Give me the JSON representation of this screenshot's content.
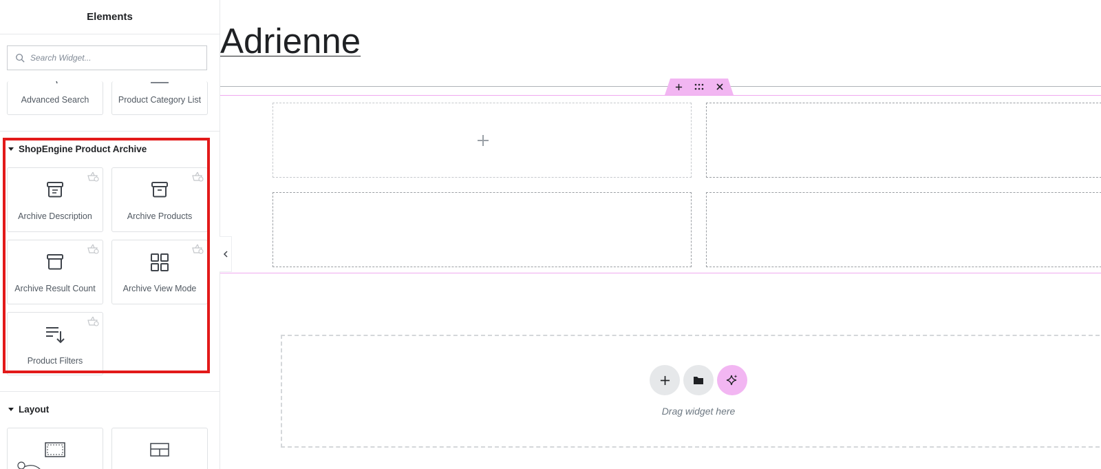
{
  "sidebar": {
    "title": "Elements",
    "search_placeholder": "Search Widget...",
    "top_widgets": [
      {
        "label": "Advanced Search"
      },
      {
        "label": "Product Category List"
      }
    ],
    "category_archive": {
      "title": "ShopEngine Product Archive",
      "widgets": [
        {
          "label": "Archive Description",
          "icon": "archive-box-icon"
        },
        {
          "label": "Archive Products",
          "icon": "archive-box-icon"
        },
        {
          "label": "Archive Result Count",
          "icon": "archive-box-icon"
        },
        {
          "label": "Archive View Mode",
          "icon": "grid-four-icon"
        },
        {
          "label": "Product Filters",
          "icon": "sort-list-icon"
        }
      ]
    },
    "category_layout": {
      "title": "Layout"
    }
  },
  "canvas": {
    "page_title": "Adrienne",
    "dropzone_text": "Drag widget here"
  },
  "colors": {
    "accent_pink": "#f2b6f2",
    "highlight_red": "#e21a1a"
  }
}
